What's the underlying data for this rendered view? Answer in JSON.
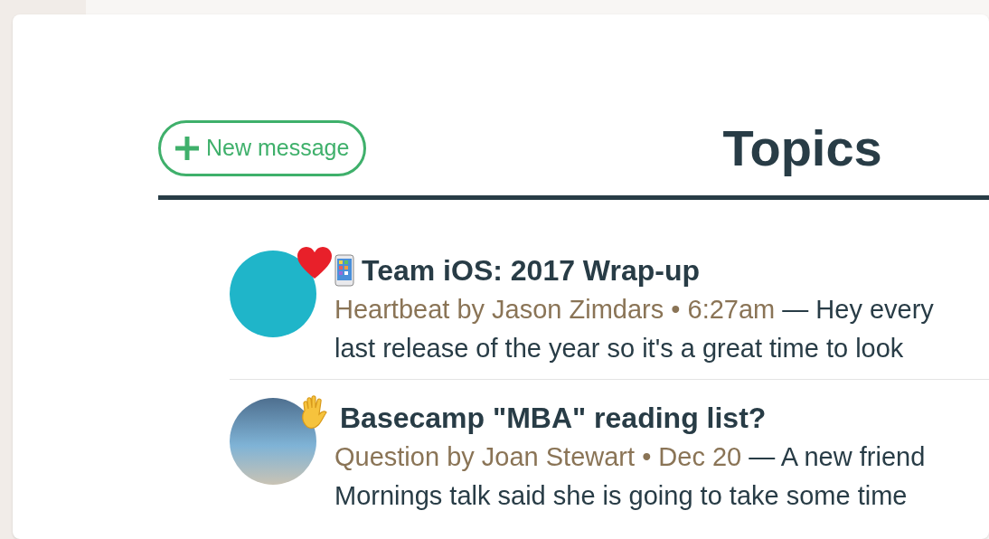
{
  "new_message_button": {
    "label": "New message"
  },
  "heading": "Topics",
  "topics": [
    {
      "kind": "heartbeat",
      "title": "Team iOS: 2017 Wrap-up",
      "meta": "Heartbeat by Jason Zimdars • 6:27am",
      "excerpt_lines": [
        "— Hey every",
        "last release of the year so it's a great time to look"
      ]
    },
    {
      "kind": "question",
      "title": "Basecamp \"MBA\" reading list?",
      "meta": "Question by Joan Stewart • Dec 20",
      "excerpt_lines": [
        "— A new friend",
        "Mornings talk said she is going to take some time"
      ]
    }
  ]
}
